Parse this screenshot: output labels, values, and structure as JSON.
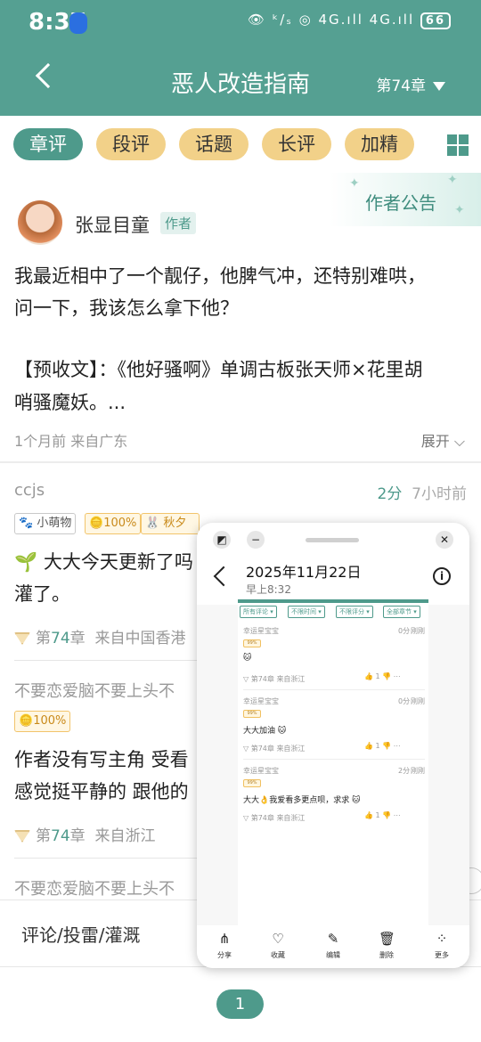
{
  "status_bar": {
    "time": "8:37",
    "icons_text": "👁 ᵏ/ₛ ◎ 4G.ıll 4G.ıll",
    "battery": "66"
  },
  "header": {
    "title": "恶人改造指南",
    "chapter": "第74章"
  },
  "tabs": [
    {
      "label": "章评",
      "active": true
    },
    {
      "label": "段评",
      "active": false
    },
    {
      "label": "话题",
      "active": false
    },
    {
      "label": "长评",
      "active": false
    },
    {
      "label": "加精",
      "active": false
    }
  ],
  "announcement": {
    "label": "作者公告",
    "author": "张显目童",
    "author_tag": "作者",
    "line1": "我最近相中了一个靓仔，他脾气冲，还特别难哄，",
    "line2": "问一下，我该怎么拿下他？",
    "line3": "【预收文】：《他好骚啊》单调古板张天师×花里胡",
    "line4": "哨骚魔妖。...",
    "meta": "1个月前 来自广东",
    "expand": "展开"
  },
  "comments": [
    {
      "user": "ccjs",
      "score_num": "2分",
      "score_time": "7小时前",
      "badges": [
        "小萌物",
        "100%",
        "秋夕"
      ],
      "line1": "🌱 大大今天更新了吗",
      "line2": "灌了。",
      "chapter_prefix": "第",
      "chapter_num": "74",
      "chapter_suffix": "章",
      "location": "来自中国香港"
    },
    {
      "user": "不要恋爱脑不要上头不",
      "badges": [
        "100%"
      ],
      "line1": "作者没有写主角 受看",
      "line2": "感觉挺平静的 跟他的",
      "chapter_prefix": "第",
      "chapter_num": "74",
      "chapter_suffix": "章",
      "location": "来自浙江"
    },
    {
      "user": "不要恋爱脑不要上头不"
    }
  ],
  "bottom_bar": {
    "placeholder": "评论/投雷/灌溉"
  },
  "pagination": {
    "current": "1"
  },
  "floating_window": {
    "date": "2025年11月22日",
    "time": "早上8:32",
    "filters": [
      "所有评论",
      "不限时间",
      "不限评分",
      "全部章节"
    ],
    "mini_comments": [
      {
        "user": "幸运星宝宝",
        "score": "0分",
        "when": "刚刚",
        "badge": "99%",
        "text": "🐱",
        "chapter": "第74章",
        "location": "来自浙江",
        "likes": "1"
      },
      {
        "user": "幸运星宝宝",
        "score": "0分",
        "when": "刚刚",
        "badge": "99%",
        "text": "大大加油 🐱",
        "chapter": "第74章",
        "location": "来自浙江",
        "likes": "1"
      },
      {
        "user": "幸运星宝宝",
        "score": "2分",
        "when": "刚刚",
        "badge": "99%",
        "text": "大大👌我爱看多更点呗，求求 🐱",
        "chapter": "第74章",
        "location": "来自浙江",
        "likes": "1"
      }
    ],
    "tools": [
      {
        "label": "分享",
        "icon": "share-icon",
        "glyph": "⋔"
      },
      {
        "label": "收藏",
        "icon": "heart-icon",
        "glyph": "♡"
      },
      {
        "label": "编辑",
        "icon": "edit-icon",
        "glyph": "✎"
      },
      {
        "label": "删除",
        "icon": "trash-icon",
        "glyph": "🗑"
      },
      {
        "label": "更多",
        "icon": "more-icon",
        "glyph": "⁘"
      }
    ]
  },
  "colors": {
    "primary": "#55a092",
    "tab_bg": "#f2d189",
    "accent_text": "#4e9a8b"
  }
}
